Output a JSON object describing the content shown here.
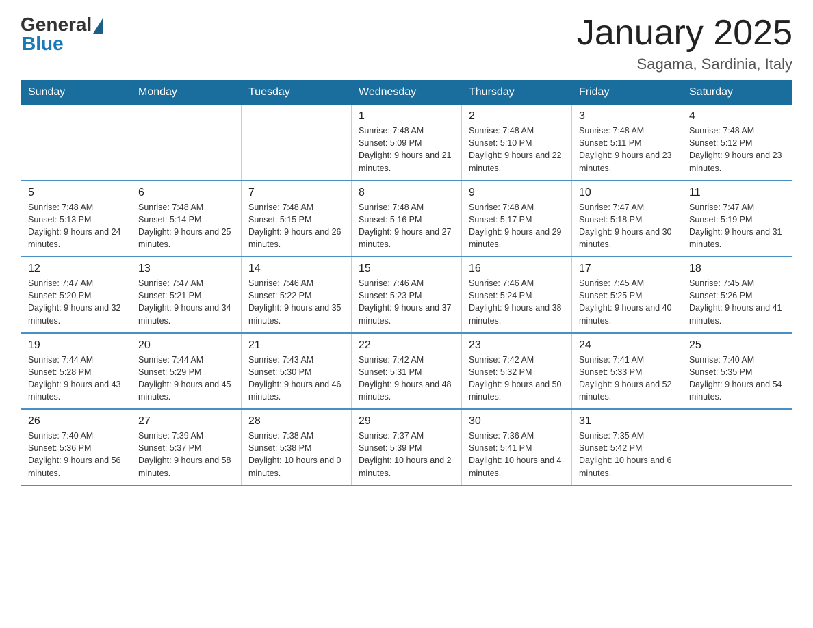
{
  "logo": {
    "general": "General",
    "blue": "Blue"
  },
  "title": "January 2025",
  "subtitle": "Sagama, Sardinia, Italy",
  "days_of_week": [
    "Sunday",
    "Monday",
    "Tuesday",
    "Wednesday",
    "Thursday",
    "Friday",
    "Saturday"
  ],
  "weeks": [
    [
      {
        "day": "",
        "info": ""
      },
      {
        "day": "",
        "info": ""
      },
      {
        "day": "",
        "info": ""
      },
      {
        "day": "1",
        "info": "Sunrise: 7:48 AM\nSunset: 5:09 PM\nDaylight: 9 hours and 21 minutes."
      },
      {
        "day": "2",
        "info": "Sunrise: 7:48 AM\nSunset: 5:10 PM\nDaylight: 9 hours and 22 minutes."
      },
      {
        "day": "3",
        "info": "Sunrise: 7:48 AM\nSunset: 5:11 PM\nDaylight: 9 hours and 23 minutes."
      },
      {
        "day": "4",
        "info": "Sunrise: 7:48 AM\nSunset: 5:12 PM\nDaylight: 9 hours and 23 minutes."
      }
    ],
    [
      {
        "day": "5",
        "info": "Sunrise: 7:48 AM\nSunset: 5:13 PM\nDaylight: 9 hours and 24 minutes."
      },
      {
        "day": "6",
        "info": "Sunrise: 7:48 AM\nSunset: 5:14 PM\nDaylight: 9 hours and 25 minutes."
      },
      {
        "day": "7",
        "info": "Sunrise: 7:48 AM\nSunset: 5:15 PM\nDaylight: 9 hours and 26 minutes."
      },
      {
        "day": "8",
        "info": "Sunrise: 7:48 AM\nSunset: 5:16 PM\nDaylight: 9 hours and 27 minutes."
      },
      {
        "day": "9",
        "info": "Sunrise: 7:48 AM\nSunset: 5:17 PM\nDaylight: 9 hours and 29 minutes."
      },
      {
        "day": "10",
        "info": "Sunrise: 7:47 AM\nSunset: 5:18 PM\nDaylight: 9 hours and 30 minutes."
      },
      {
        "day": "11",
        "info": "Sunrise: 7:47 AM\nSunset: 5:19 PM\nDaylight: 9 hours and 31 minutes."
      }
    ],
    [
      {
        "day": "12",
        "info": "Sunrise: 7:47 AM\nSunset: 5:20 PM\nDaylight: 9 hours and 32 minutes."
      },
      {
        "day": "13",
        "info": "Sunrise: 7:47 AM\nSunset: 5:21 PM\nDaylight: 9 hours and 34 minutes."
      },
      {
        "day": "14",
        "info": "Sunrise: 7:46 AM\nSunset: 5:22 PM\nDaylight: 9 hours and 35 minutes."
      },
      {
        "day": "15",
        "info": "Sunrise: 7:46 AM\nSunset: 5:23 PM\nDaylight: 9 hours and 37 minutes."
      },
      {
        "day": "16",
        "info": "Sunrise: 7:46 AM\nSunset: 5:24 PM\nDaylight: 9 hours and 38 minutes."
      },
      {
        "day": "17",
        "info": "Sunrise: 7:45 AM\nSunset: 5:25 PM\nDaylight: 9 hours and 40 minutes."
      },
      {
        "day": "18",
        "info": "Sunrise: 7:45 AM\nSunset: 5:26 PM\nDaylight: 9 hours and 41 minutes."
      }
    ],
    [
      {
        "day": "19",
        "info": "Sunrise: 7:44 AM\nSunset: 5:28 PM\nDaylight: 9 hours and 43 minutes."
      },
      {
        "day": "20",
        "info": "Sunrise: 7:44 AM\nSunset: 5:29 PM\nDaylight: 9 hours and 45 minutes."
      },
      {
        "day": "21",
        "info": "Sunrise: 7:43 AM\nSunset: 5:30 PM\nDaylight: 9 hours and 46 minutes."
      },
      {
        "day": "22",
        "info": "Sunrise: 7:42 AM\nSunset: 5:31 PM\nDaylight: 9 hours and 48 minutes."
      },
      {
        "day": "23",
        "info": "Sunrise: 7:42 AM\nSunset: 5:32 PM\nDaylight: 9 hours and 50 minutes."
      },
      {
        "day": "24",
        "info": "Sunrise: 7:41 AM\nSunset: 5:33 PM\nDaylight: 9 hours and 52 minutes."
      },
      {
        "day": "25",
        "info": "Sunrise: 7:40 AM\nSunset: 5:35 PM\nDaylight: 9 hours and 54 minutes."
      }
    ],
    [
      {
        "day": "26",
        "info": "Sunrise: 7:40 AM\nSunset: 5:36 PM\nDaylight: 9 hours and 56 minutes."
      },
      {
        "day": "27",
        "info": "Sunrise: 7:39 AM\nSunset: 5:37 PM\nDaylight: 9 hours and 58 minutes."
      },
      {
        "day": "28",
        "info": "Sunrise: 7:38 AM\nSunset: 5:38 PM\nDaylight: 10 hours and 0 minutes."
      },
      {
        "day": "29",
        "info": "Sunrise: 7:37 AM\nSunset: 5:39 PM\nDaylight: 10 hours and 2 minutes."
      },
      {
        "day": "30",
        "info": "Sunrise: 7:36 AM\nSunset: 5:41 PM\nDaylight: 10 hours and 4 minutes."
      },
      {
        "day": "31",
        "info": "Sunrise: 7:35 AM\nSunset: 5:42 PM\nDaylight: 10 hours and 6 minutes."
      },
      {
        "day": "",
        "info": ""
      }
    ]
  ]
}
